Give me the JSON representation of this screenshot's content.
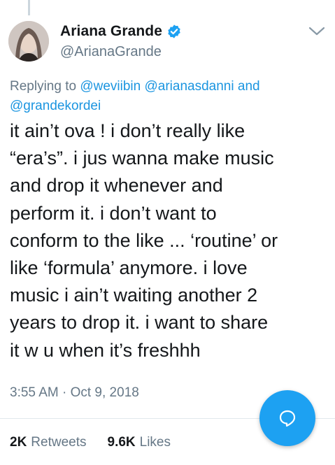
{
  "author": {
    "display_name": "Ariana Grande",
    "handle": "@ArianaGrande",
    "verified": true
  },
  "reply": {
    "prefix": "Replying to",
    "mentions": [
      "@weviibin",
      "@arianasdanni",
      "and",
      "@grandekordei"
    ]
  },
  "tweet": {
    "lines": [
      "it ain’t ova ! i don’t really like",
      "“era’s”. i jus wanna make music",
      "and drop it whenever and",
      "perform it. i don’t want to",
      "conform to the like ... ‘routine’ or",
      "like ‘formula’ anymore. i love",
      "music i ain’t waiting another 2",
      "years to drop it. i want to share",
      "it w u when it’s freshhh"
    ],
    "timestamp": "3:55 AM · Oct 9, 2018"
  },
  "stats": {
    "retweets_count": "2K",
    "retweets_label": "Retweets",
    "likes_count": "9.6K",
    "likes_label": "Likes"
  },
  "icons": {
    "verified": "verified-badge-icon",
    "menu": "chevron-down-icon",
    "compose": "reply-bubble-icon"
  },
  "colors": {
    "accent": "#1da1f2",
    "link": "#1b95e0",
    "secondary_text": "#657786"
  }
}
